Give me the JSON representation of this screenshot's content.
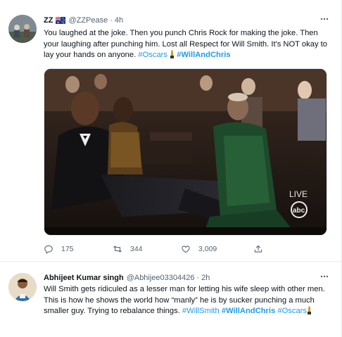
{
  "tweets": [
    {
      "name": "ZZ",
      "handle": "@ZZPease",
      "separator": "·",
      "time": "4h",
      "text_plain": "You laughed at the joke. Then you punch Chris Rock for making the joke. Then your laughing after punching him. Lost all Respect for Will Smith. It's NOT okay to lay your hands on anyone. ",
      "tag1": "#Oscars",
      "tag2": "#WillAndChris",
      "replies": "175",
      "retweets": "344",
      "likes": "3,009",
      "media_badge": "LIVE",
      "media_network": "abc"
    },
    {
      "name": "Abhijeet Kumar singh",
      "handle": "@Abhijee03304426",
      "separator": "·",
      "time": "2h",
      "text_plain": "Will Smith gets ridiculed as a lesser man for letting his wife sleep with other men.  This is how he shows the world how “manly” he is by sucker punching a much smaller guy.  Trying to rebalance things. ",
      "tag1": "#WillSmith",
      "tag2": "#WillAndChris",
      "tag3": "#Oscars"
    }
  ],
  "colors": {
    "link": "#1d9bf0",
    "text": "#0f1419",
    "secondary": "#536471",
    "border": "#e6ecf0"
  },
  "icons": [
    "more-icon",
    "flag-icon",
    "oscar-statue-icon",
    "reply-icon",
    "retweet-icon",
    "like-icon",
    "share-icon"
  ]
}
